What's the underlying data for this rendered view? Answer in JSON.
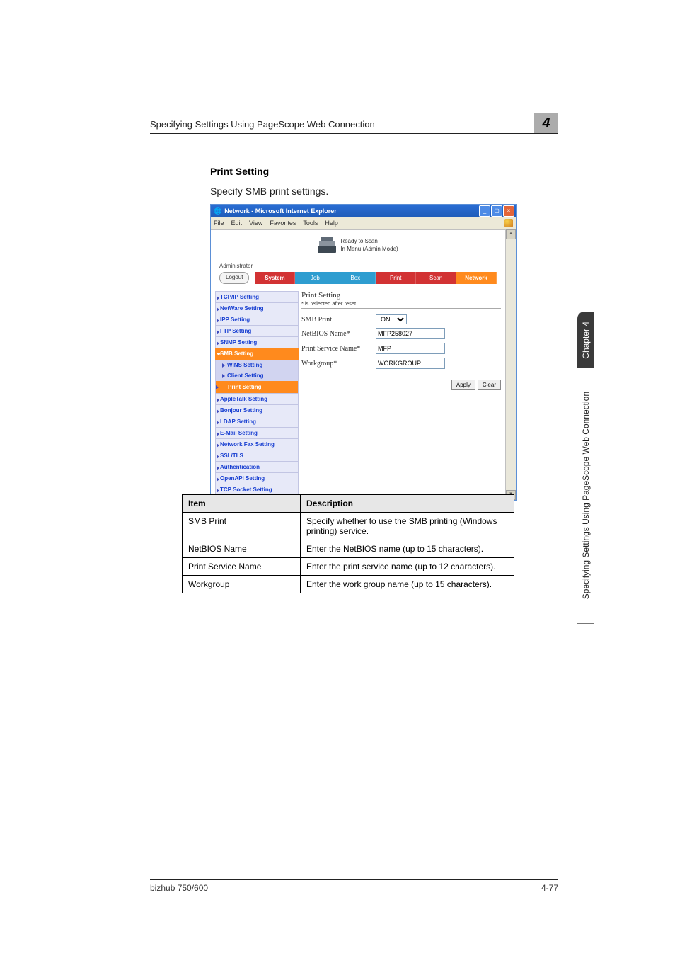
{
  "page": {
    "header": "Specifying Settings Using PageScope Web Connection",
    "badge": "4",
    "section_title": "Print Setting",
    "section_desc": "Specify SMB print settings.",
    "footer_left": "bizhub 750/600",
    "footer_right": "4-77",
    "side_chapter": "Chapter 4",
    "side_text": "Specifying Settings Using PageScope Web Connection"
  },
  "browser": {
    "title": "Network - Microsoft Internet Explorer",
    "menus": [
      "File",
      "Edit",
      "View",
      "Favorites",
      "Tools",
      "Help"
    ],
    "status1": "Ready to Scan",
    "status2": "In Menu (Admin Mode)",
    "user": "Administrator",
    "logout": "Logout",
    "tabs": {
      "system": "System",
      "job": "Job",
      "box": "Box",
      "print": "Print",
      "scan": "Scan",
      "network": "Network"
    }
  },
  "sidebar": {
    "items": [
      "TCP/IP Setting",
      "NetWare Setting",
      "IPP Setting",
      "FTP Setting",
      "SNMP Setting",
      "SMB Setting",
      "AppleTalk Setting",
      "Bonjour Setting",
      "LDAP Setting",
      "E-Mail Setting",
      "Network Fax Setting",
      "SSL/TLS",
      "Authentication",
      "OpenAPI Setting",
      "TCP Socket Setting"
    ],
    "sub": {
      "wins": "WINS Setting",
      "client": "Client Setting",
      "print": "Print Setting"
    }
  },
  "panel": {
    "title": "Print Setting",
    "note": "* is reflected after reset.",
    "rows": {
      "smb_print": {
        "label": "SMB Print",
        "value": "ON"
      },
      "netbios": {
        "label": "NetBIOS Name*",
        "value": "MFP258027"
      },
      "service": {
        "label": "Print Service Name*",
        "value": "MFP"
      },
      "workgroup": {
        "label": "Workgroup*",
        "value": "WORKGROUP"
      }
    },
    "apply": "Apply",
    "clear": "Clear"
  },
  "desc_table": {
    "head_item": "Item",
    "head_desc": "Description",
    "rows": [
      {
        "item": "SMB Print",
        "desc": "Specify whether to use the SMB printing (Windows printing) service."
      },
      {
        "item": "NetBIOS Name",
        "desc": "Enter the NetBIOS name (up to 15 characters)."
      },
      {
        "item": "Print Service Name",
        "desc": "Enter the print service name (up to 12 characters)."
      },
      {
        "item": "Workgroup",
        "desc": "Enter the work group name (up to 15 characters)."
      }
    ]
  }
}
